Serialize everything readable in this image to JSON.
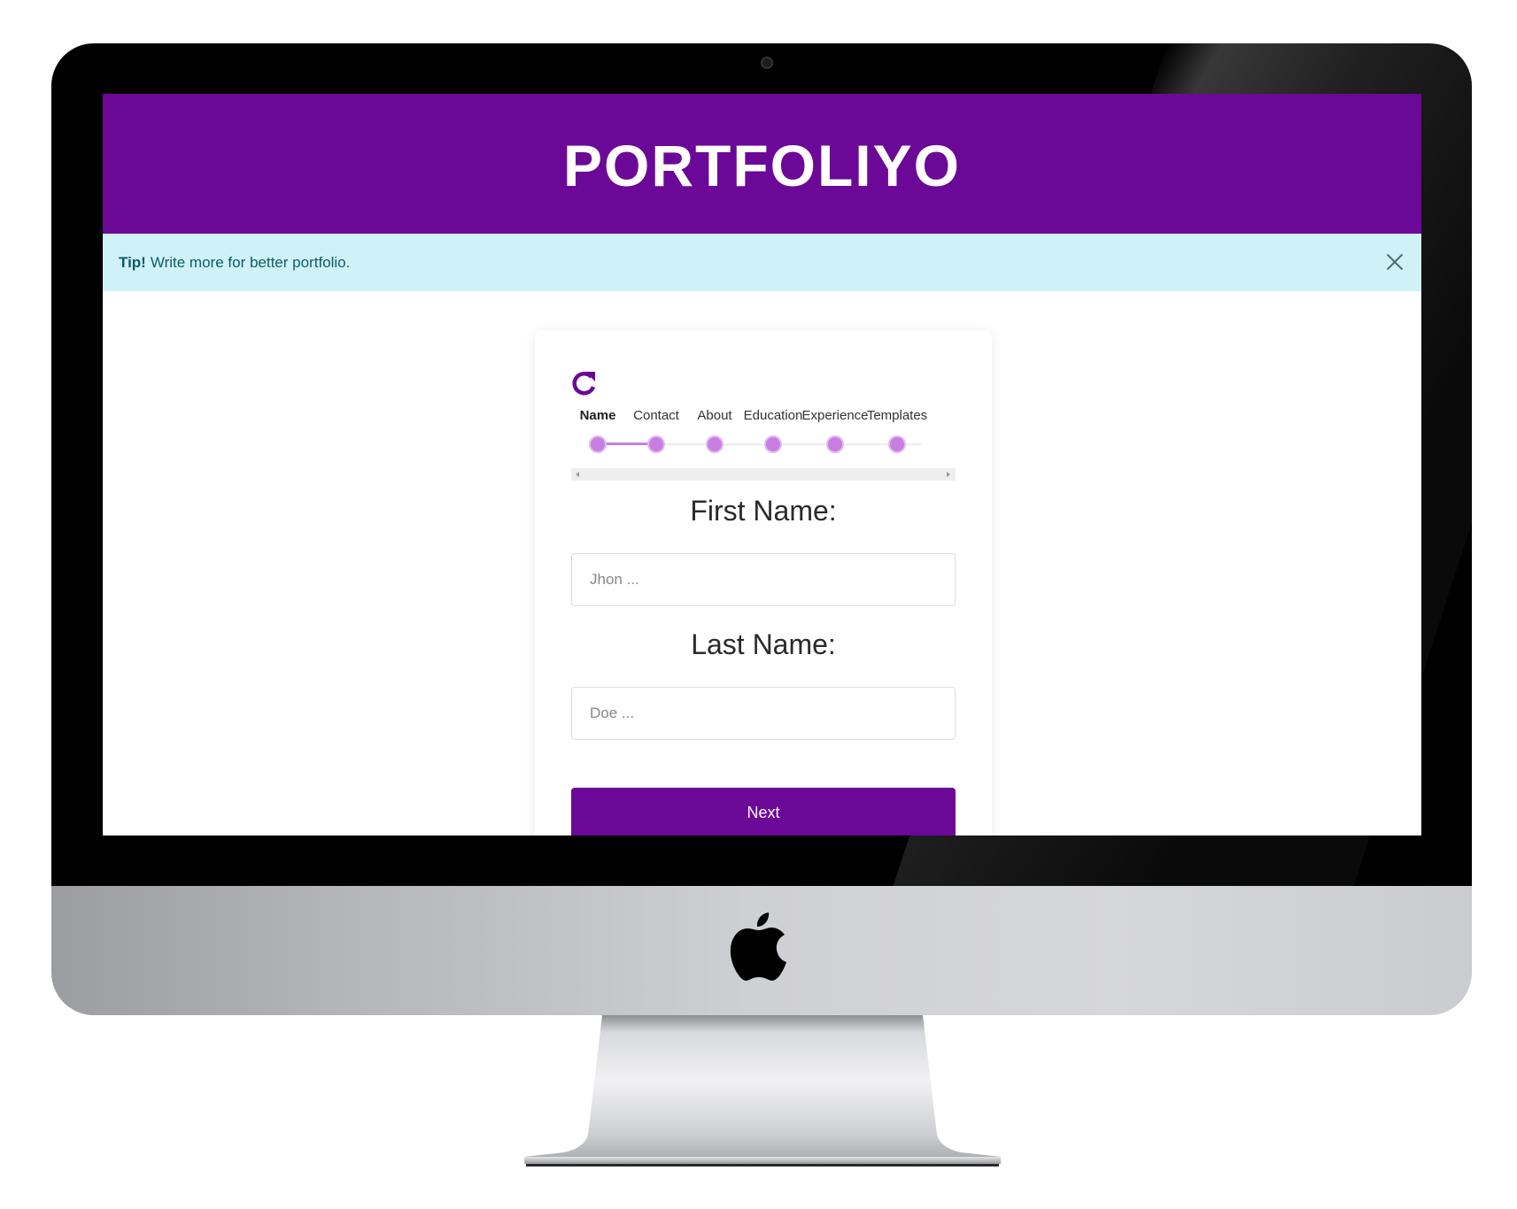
{
  "app": {
    "title": "PORTFOLIYO",
    "brand_color": "#6c0898"
  },
  "tip": {
    "label": "Tip!",
    "message": "Write more for better portfolio.",
    "close_icon": "close-icon"
  },
  "wizard": {
    "reset_icon": "refresh-icon",
    "active_step": 0,
    "steps": [
      {
        "label": "Name"
      },
      {
        "label": "Contact"
      },
      {
        "label": "About"
      },
      {
        "label": "Education"
      },
      {
        "label": "Experience"
      },
      {
        "label": "Templates"
      }
    ],
    "step_color": "#c77ee0"
  },
  "form": {
    "first_name": {
      "label": "First Name:",
      "placeholder": "Jhon ...",
      "value": ""
    },
    "last_name": {
      "label": "Last Name:",
      "placeholder": "Doe ...",
      "value": ""
    },
    "next_label": "Next"
  },
  "device": {
    "logo_icon": "apple-logo-icon"
  }
}
